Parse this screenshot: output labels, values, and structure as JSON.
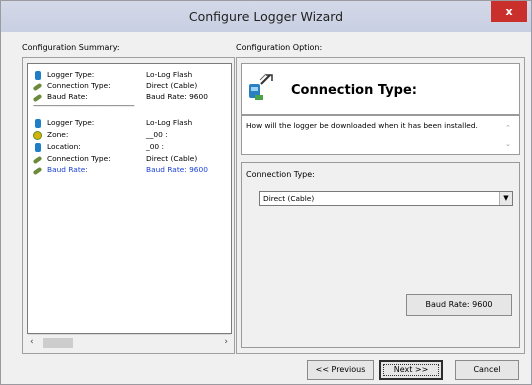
{
  "window": {
    "title": "Configure Logger Wizard",
    "close_label": "x"
  },
  "left": {
    "group_label": "Configuration Summary:",
    "rows": [
      {
        "icon": "logger-icon",
        "key": "Logger Type:",
        "value": "Lo-Log Flash"
      },
      {
        "icon": "connection-icon",
        "key": "Connection Type:",
        "value": "Direct (Cable)"
      },
      {
        "icon": "connection-icon",
        "key": "Baud Rate:",
        "value": "Baud Rate: 9600"
      },
      {
        "icon": "logger-icon",
        "key": "Logger Type:",
        "value": "Lo-Log Flash"
      },
      {
        "icon": "zone-icon",
        "key": "Zone:",
        "value": "__00 :"
      },
      {
        "icon": "logger-icon",
        "key": "Location:",
        "value": "_00 :"
      },
      {
        "icon": "connection-icon",
        "key": "Connection Type:",
        "value": "Direct (Cable)"
      },
      {
        "icon": "connection-icon",
        "key": "Baud Rate:",
        "value": "Baud Rate: 9600",
        "selected": true
      }
    ],
    "separator": "------------------------------------------------------------------"
  },
  "right": {
    "group_label": "Configuration Option:",
    "heading": "Connection Type:",
    "description": "How will the logger be downloaded when it has been installed.",
    "field_label": "Connection Type:",
    "select_value": "Direct (Cable)",
    "baud_button": "Baud Rate: 9600"
  },
  "footer": {
    "previous": "<< Previous",
    "next": "Next >>",
    "cancel": "Cancel"
  }
}
